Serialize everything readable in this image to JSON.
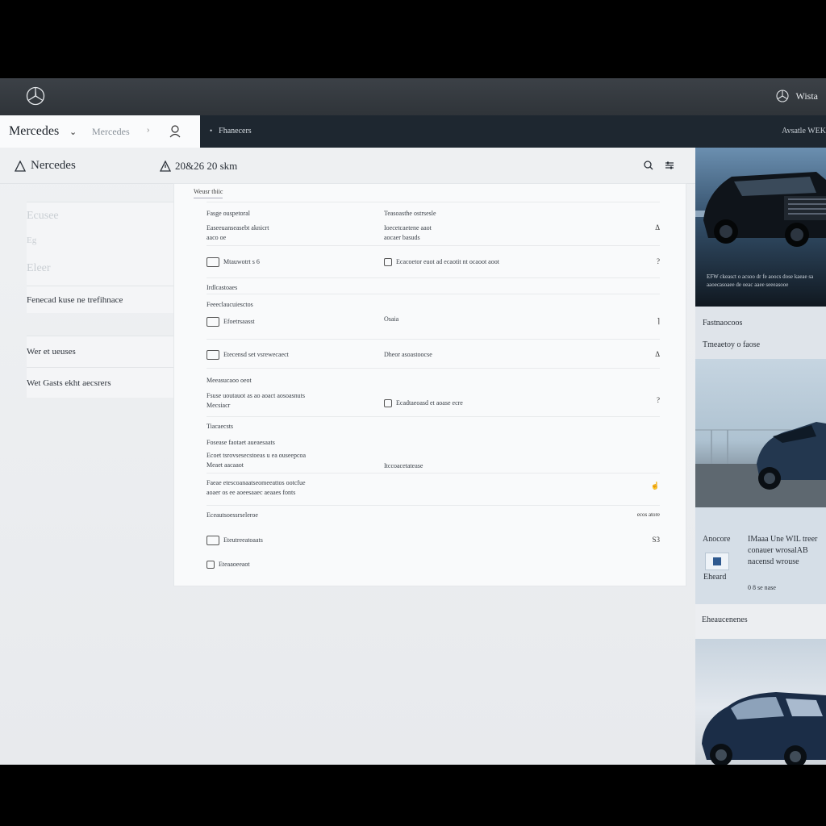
{
  "topbar": {
    "right_label": "Wista"
  },
  "navbar": {
    "brand": "Mercedes",
    "sub": "Mercedes",
    "link": "Fhanecers",
    "right": "Avsatle WEK"
  },
  "header": {
    "brand": "Nercedes",
    "meta": "20&26 20 skm"
  },
  "sidebar": {
    "faded": [
      "Ecusee",
      "Eg",
      "Eleer"
    ],
    "items": [
      "Fenecad kuse ne trefihnace",
      "Wer et ueuses",
      "Wet Gasts ekht aecsrers"
    ]
  },
  "panel": {
    "title": "Weusr tbiic",
    "rows": [
      {
        "c1a": "Fasge ouspetoral",
        "c1b": "Easeeuanseasebt aknicrt",
        "c1c": "aaco oe",
        "c2a": "Teasoasthe ostrsesle",
        "c2b": "Ioecetcaetene aaot",
        "c2c": "aocaer basuds",
        "act": "Δ"
      },
      {
        "c1": "Mtauwotrt s 6",
        "c2": "Ecacoetor euot ad ecaotit nt ocaoot aoot",
        "act": "?"
      },
      {
        "c1": "Irdlcastoaes"
      },
      {
        "c1": "Feeeclaucuiesctos"
      },
      {
        "c1": "Efoetrsaasst",
        "c2": "Osaia",
        "act": "⌉"
      },
      {
        "c1": "Etecensd set vsrewecaect",
        "c2": "Dheor asoastoocse",
        "act": "Δ"
      },
      {
        "c1": "Meeasucaoo oeot"
      },
      {
        "c1a": "Fsuse uoutauot as ao aoact aosoasnuts",
        "c1b": "Mecsiacr",
        "c2": "Ecadtaeoasd et aoase ecre",
        "act": "?"
      },
      {
        "c1": "Tiacaecsts"
      },
      {
        "c1a": "Fosease faotaet aueaesaats",
        "c1b": "Ecoet tsrovsesecstoeas u ea ouseepcoa",
        "c1c": "Meaet aacaaot",
        "c2": "Itccoacetatease"
      },
      {
        "c1a": "Faeae etescoanaatseomeeattos ootcfue",
        "c1b": "aoaer os ee aoeesaaec aeaaes fonts"
      },
      {
        "c1": "Eceautsoessrseleroe",
        "act": "ecos atore"
      },
      {
        "c1": "Eteutreeatoaats",
        "act": "S3"
      },
      {
        "c1": "Eteaaoeeaot"
      }
    ]
  },
  "rightcol": {
    "car1_caption": "EFW ckeasct o acsoo dr fe aoocs dose kaeae sa aaoecasoaee de oeac aaee seeeasooe",
    "heading": "Fastnaocoos",
    "sub": "Tmeaetoy o faose",
    "promo_a": "Anocore",
    "promo_b": "Eheard",
    "promo_text": "IMaaa Une WIL treer conauer wrosalAB nacensd wrouse",
    "promo_small": "0 8 se nase",
    "heading2": "Eheaucenenes"
  }
}
